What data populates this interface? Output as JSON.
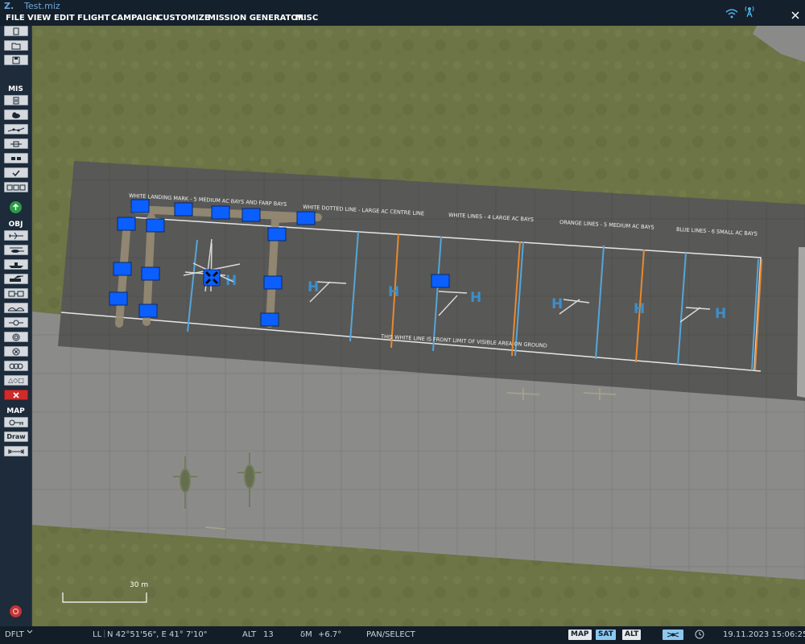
{
  "app": {
    "logo": "Z.",
    "file_name": "Test.miz"
  },
  "menu": [
    "FILE",
    "VIEW",
    "EDIT",
    "FLIGHT",
    "CAMPAIGN",
    "CUSTOMIZE",
    "MISSION GENERATOR",
    "MISC"
  ],
  "sidebar": {
    "file_buttons": [
      "new-file-icon",
      "open-folder-icon",
      "save-icon"
    ],
    "mis_label": "MIS",
    "mis_buttons": [
      "briefing-icon",
      "weather-icon",
      "trigger-zone-icon",
      "waypoint-icon",
      "flag-icon",
      "check-icon",
      "route-icon"
    ],
    "go_icon": "go-arrow-icon",
    "obj_label": "OBJ",
    "obj_buttons": [
      "airplane-icon",
      "helicopter-icon",
      "ship-icon",
      "vehicle-icon",
      "static-object-icon",
      "bridge-icon",
      "target-icon",
      "radius-icon",
      "delete-object-icon",
      "group-icon",
      "shapes-icon"
    ],
    "delete_icon": "delete-icon",
    "map_label": "MAP",
    "map_buttons": [
      "ruler-icon",
      "draw-button",
      "measure-icon"
    ],
    "draw_label": "Draw",
    "shapes_label": "△◇□"
  },
  "map": {
    "annotations": [
      "WHITE LANDING MARK - 5 MEDIUM AC BAYS AND FARP BAYS",
      "WHITE DOTTED LINE - LARGE AC CENTRE LINE",
      "WHITE LINES - 4 LARGE AC BAYS",
      "ORANGE LINES - 5 MEDIUM AC BAYS",
      "BLUE LINES - 6 SMALL AC BAYS",
      "THIS WHITE LINE IS FRONT LIMIT OF VISIBLE AREA ON GROUND"
    ],
    "pad_letter": "H",
    "scale": "30 m",
    "colors": {
      "grass": "#6f7547",
      "apron": "#575755",
      "taxiway": "#8a8b89",
      "white": "#e8e8e8",
      "orange": "#e8892f",
      "blue": "#56a5d8",
      "object": "#0b5fff"
    }
  },
  "status": {
    "profile": "DFLT",
    "coord_mode": "LL",
    "coords": "N 42°51'56\", E 41° 7'10\"",
    "alt_label": "ALT",
    "alt_value": "13",
    "dm_label": "δM",
    "dm_value": "+6.7°",
    "mode": "PAN/SELECT",
    "map_btn": "MAP",
    "sat_btn": "SAT",
    "alt_btn": "ALT",
    "datetime": "19.11.2023 15:06:25"
  }
}
